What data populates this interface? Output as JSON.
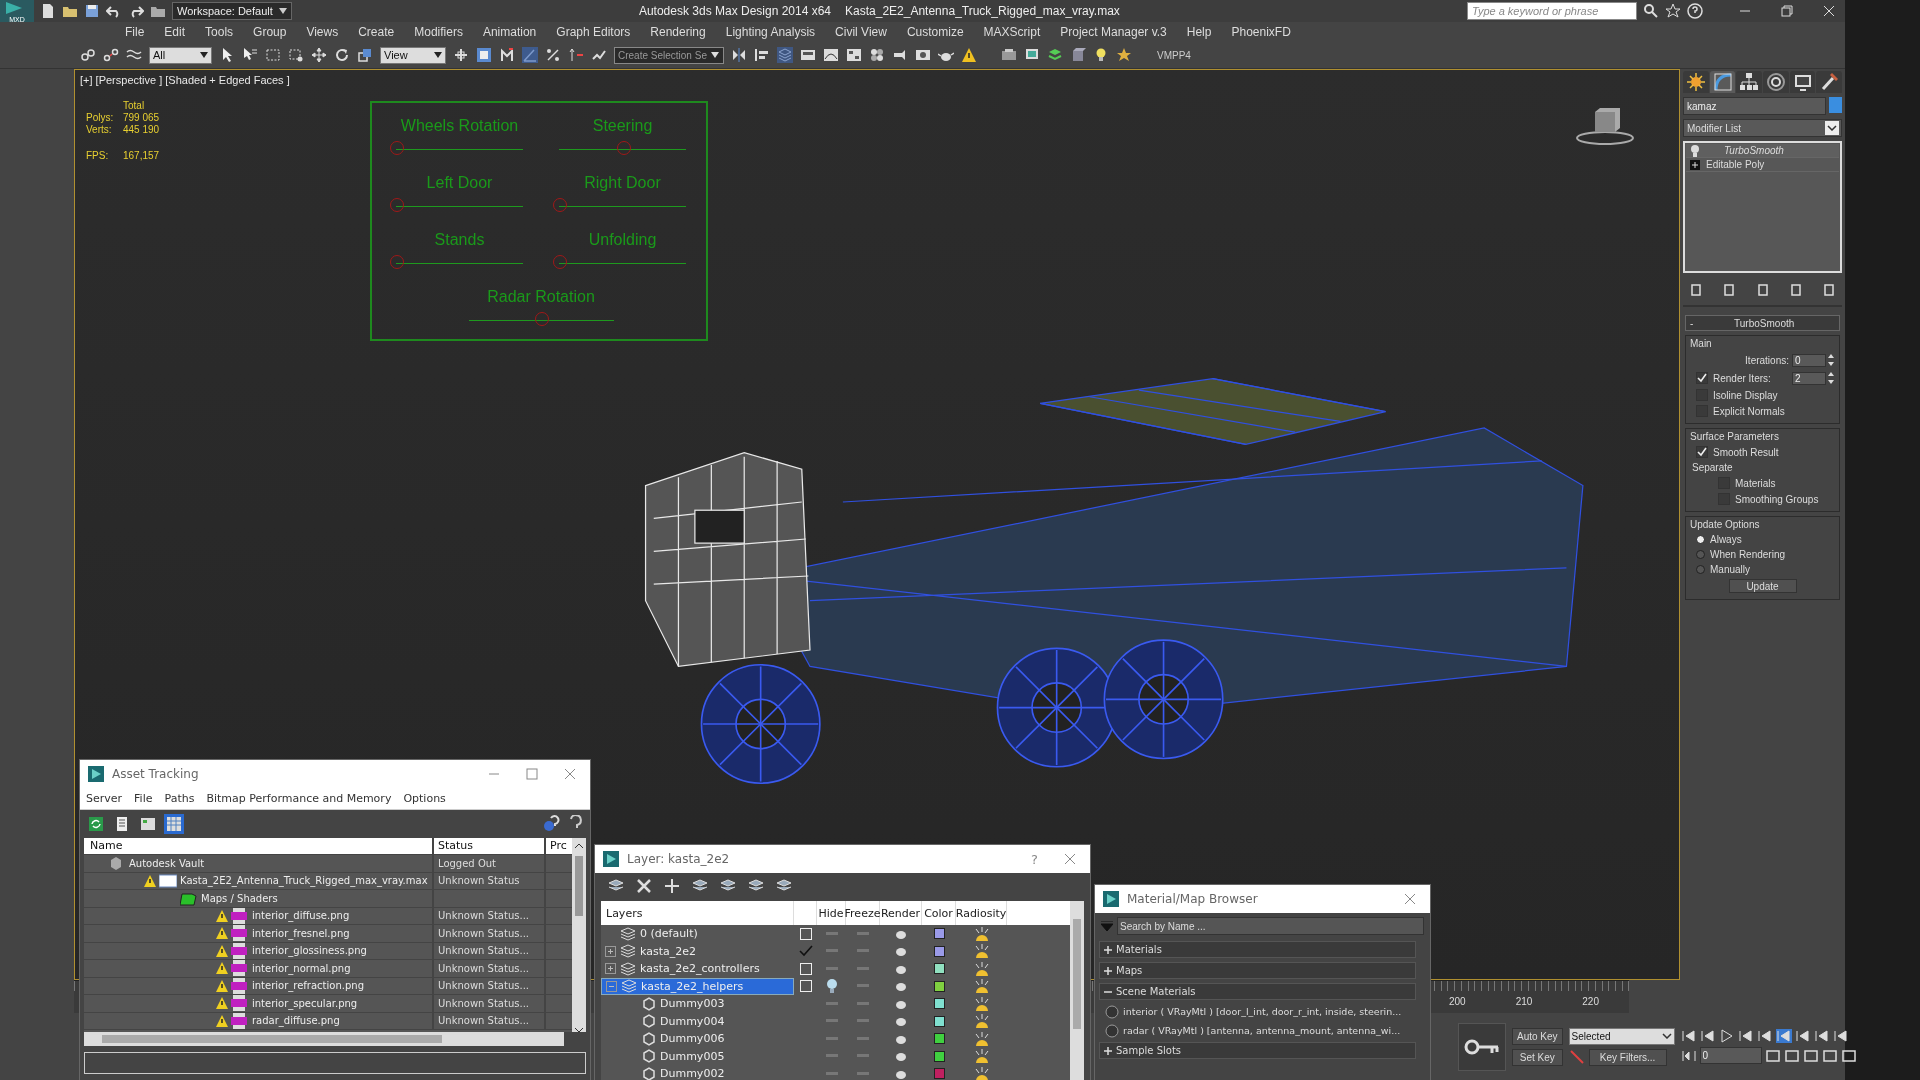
{
  "title_bar": {
    "app_badge": "MXD",
    "workspace": "Workspace: Default",
    "app_title": "Autodesk 3ds Max Design 2014 x64",
    "file_title": "Kasta_2E2_Antenna_Truck_Rigged_max_vray.max",
    "search": {
      "placeholder": "Type a keyword or phrase"
    }
  },
  "menu": [
    "File",
    "Edit",
    "Tools",
    "Group",
    "Views",
    "Create",
    "Modifiers",
    "Animation",
    "Graph Editors",
    "Rendering",
    "Lighting Analysis",
    "Civil View",
    "Customize",
    "MAXScript",
    "Project Manager v.3",
    "Help",
    "PhoenixFD"
  ],
  "toolbar": {
    "selection_filter": "All",
    "reference_coordinate": "View",
    "selection_set": {
      "placeholder": "Create Selection Se"
    },
    "plugin_label": "VMPP4"
  },
  "viewport": {
    "label": "[+] [Perspective ] [Shaded + Edged Faces ]",
    "stats": {
      "header": "Total",
      "rows": [
        {
          "label": "Polys:",
          "value": "799 065"
        },
        {
          "label": "Verts:",
          "value": "445 190"
        }
      ],
      "fps": {
        "label": "FPS:",
        "value": "167,157"
      }
    },
    "rig_controls": [
      {
        "label": "Wheels Rotation",
        "level": 0
      },
      {
        "label": "Steering",
        "level": 0.5
      },
      {
        "label": "Left Door",
        "level": 0
      },
      {
        "label": "Right Door",
        "level": 0
      },
      {
        "label": "Stands",
        "level": 0
      },
      {
        "label": "Unfolding",
        "level": 0
      },
      {
        "label": "Radar Rotation",
        "level": 0.5
      }
    ]
  },
  "command_panel": {
    "tabs": [
      {
        "kind": "create",
        "selected": false
      },
      {
        "kind": "modify",
        "selected": true
      },
      {
        "kind": "hierarchy",
        "selected": false
      },
      {
        "kind": "motion",
        "selected": false
      },
      {
        "kind": "display",
        "selected": false
      },
      {
        "kind": "utilities",
        "selected": false
      }
    ],
    "object_name": "kamaz",
    "modifier_list": "Modifier List",
    "stack": [
      {
        "name": "TurboSmooth",
        "selected": true
      },
      {
        "name": "Editable Poly",
        "selected": false
      }
    ],
    "rollout": {
      "title": "TurboSmooth",
      "collapse": "-",
      "main": {
        "title": "Main",
        "iterations": {
          "label": "Iterations:",
          "value": "0"
        },
        "render_iters": {
          "label": "Render Iters:",
          "checked": true,
          "value": "2"
        },
        "options": [
          {
            "label": "Isoline Display",
            "checked": false
          },
          {
            "label": "Explicit Normals",
            "checked": false
          }
        ]
      },
      "surface": {
        "title": "Surface Parameters",
        "smooth_result": {
          "label": "Smooth Result",
          "checked": true
        },
        "separate": "Separate",
        "options": [
          {
            "label": "Materials",
            "checked": false
          },
          {
            "label": "Smoothing Groups",
            "checked": false
          }
        ]
      },
      "update": {
        "title": "Update Options",
        "radios": [
          {
            "label": "Always",
            "selected": true
          },
          {
            "label": "When Rendering",
            "selected": false
          },
          {
            "label": "Manually",
            "selected": false
          }
        ],
        "button": "Update"
      }
    }
  },
  "timeline": {
    "ticks": [
      "200",
      "210",
      "220"
    ],
    "auto_key": "Auto Key",
    "set_key": "Set Key",
    "key_mode": "Selected",
    "key_filters": "Key Filters...",
    "frame": "0"
  },
  "asset_tracking": {
    "title": "Asset Tracking",
    "menu": [
      "Server",
      "File",
      "Paths",
      "Bitmap Performance and Memory",
      "Options"
    ],
    "views": [
      {
        "kind": "refresh",
        "selected": false
      },
      {
        "kind": "list",
        "selected": false
      },
      {
        "kind": "thumbnails",
        "selected": false
      },
      {
        "kind": "table",
        "selected": true
      }
    ],
    "columns": [
      "Name",
      "Status",
      "Prc"
    ],
    "tree": [
      {
        "kind": "vault",
        "name": "Autodesk Vault",
        "status": "Logged Out",
        "warning": false,
        "children": [
          {
            "kind": "max_file",
            "name": "Kasta_2E2_Antenna_Truck_Rigged_max_vray.max",
            "status": "Unknown Status",
            "warning": true,
            "children": [
              {
                "kind": "folder",
                "name": "Maps / Shaders",
                "warning": false,
                "children": [
                  {
                    "kind": "png",
                    "name": "interior_diffuse.png",
                    "status": "Unknown Status...",
                    "warning": true
                  },
                  {
                    "kind": "png",
                    "name": "interior_fresnel.png",
                    "status": "Unknown Status...",
                    "warning": true
                  },
                  {
                    "kind": "png",
                    "name": "interior_glossiness.png",
                    "status": "Unknown Status...",
                    "warning": true
                  },
                  {
                    "kind": "png",
                    "name": "interior_normal.png",
                    "status": "Unknown Status...",
                    "warning": true
                  },
                  {
                    "kind": "png",
                    "name": "interior_refraction.png",
                    "status": "Unknown Status...",
                    "warning": true
                  },
                  {
                    "kind": "png",
                    "name": "interior_specular.png",
                    "status": "Unknown Status...",
                    "warning": true
                  },
                  {
                    "kind": "png",
                    "name": "radar_diffuse.png",
                    "status": "Unknown Status...",
                    "warning": true
                  }
                ]
              }
            ]
          }
        ]
      }
    ]
  },
  "layer_dialog": {
    "title": "Layer: kasta_2e2",
    "help": "?",
    "columns": [
      "Layers",
      "Hide",
      "Freeze",
      "Render",
      "Color",
      "Radiosity"
    ],
    "layers": [
      {
        "kind": "layer",
        "name": "0 (default)",
        "current": false,
        "selected": false,
        "hidden": false,
        "color": "#9a9ae8"
      },
      {
        "kind": "layer",
        "name": "kasta_2e2",
        "current": true,
        "selected": false,
        "hidden": false,
        "expanded": false,
        "color": "#9a9ae8"
      },
      {
        "kind": "layer",
        "name": "kasta_2e2_controllers",
        "current": false,
        "selected": false,
        "hidden": false,
        "expanded": false,
        "color": "#90e0c0"
      },
      {
        "kind": "layer",
        "name": "kasta_2e2_helpers",
        "current": false,
        "selected": true,
        "hidden": true,
        "expanded": true,
        "color": "#80d040",
        "children": [
          {
            "kind": "object",
            "name": "Dummy003",
            "selected": false,
            "hidden": false,
            "color": "#80e0d0"
          },
          {
            "kind": "object",
            "name": "Dummy004",
            "selected": false,
            "hidden": false,
            "color": "#80e0d0"
          },
          {
            "kind": "object",
            "name": "Dummy006",
            "selected": false,
            "hidden": false,
            "color": "#40d040"
          },
          {
            "kind": "object",
            "name": "Dummy005",
            "selected": false,
            "hidden": false,
            "color": "#40d040"
          },
          {
            "kind": "object",
            "name": "Dummy002",
            "selected": false,
            "hidden": false,
            "color": "#c02060"
          }
        ]
      }
    ]
  },
  "material_browser": {
    "title": "Material/Map Browser",
    "search": {
      "placeholder": "Search by Name ..."
    },
    "sections": [
      {
        "label": "Materials",
        "expanded": false
      },
      {
        "label": "Maps",
        "expanded": false
      },
      {
        "label": "Scene Materials",
        "expanded": true,
        "items": [
          "interior  ( VRayMtl ) [door_l_int, door_r_int, inside, steerin...",
          "radar  ( VRayMtl )  [antenna, antenna_mount, antenna_wi..."
        ]
      },
      {
        "label": "Sample Slots",
        "expanded": false
      }
    ]
  }
}
